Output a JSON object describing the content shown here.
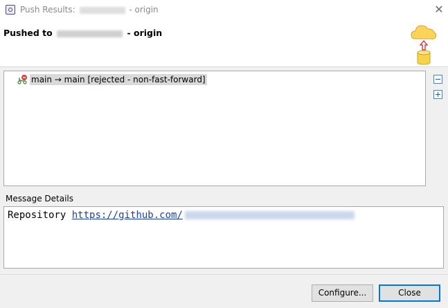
{
  "window": {
    "title_prefix": "Push Results:",
    "title_suffix": "- origin",
    "close_symbol": "✕"
  },
  "header": {
    "pushed_prefix": "Pushed to",
    "pushed_suffix": "- origin"
  },
  "tree": {
    "items": [
      {
        "label": "main → main [rejected - non-fast-forward]",
        "icon": "branch-rejected-icon"
      }
    ]
  },
  "side_buttons": [
    "collapse-all-icon",
    "expand-all-icon"
  ],
  "message": {
    "label": "Message Details",
    "prefix": "Repository",
    "link": "https://github.com/"
  },
  "buttons": {
    "configure": "Configure...",
    "close": "Close"
  },
  "colors": {
    "accent": "#0078d7",
    "link": "#1a3fb0",
    "selection": "#d9d9d9"
  }
}
